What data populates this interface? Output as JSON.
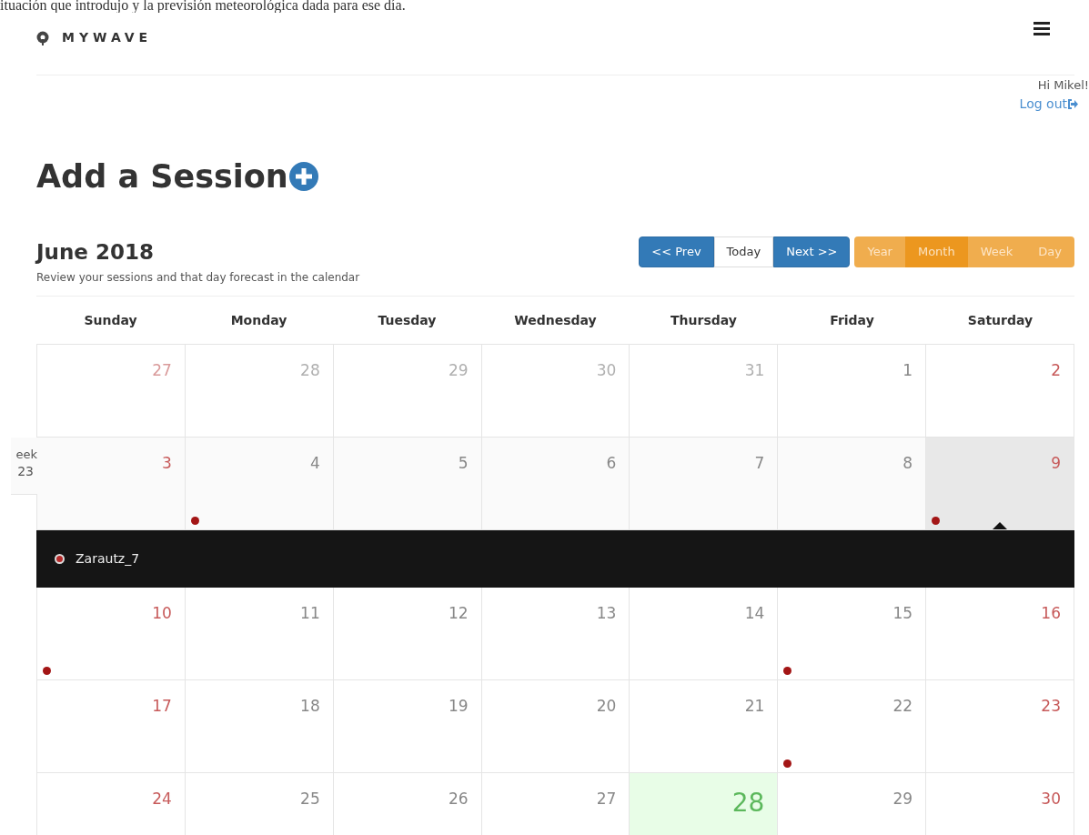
{
  "top_caption": "ituación que introdujo y la previsión meteorológica dada para ese día.",
  "brand": {
    "name": "MYWAVE"
  },
  "user": {
    "greeting": "Hi Mikel!",
    "logout": "Log out"
  },
  "page_title": "Add a Session",
  "calendar": {
    "title": "June 2018",
    "subtitle": "Review your sessions and that day forecast in the calendar",
    "nav": [
      {
        "label": "<< Prev",
        "kind": "primary"
      },
      {
        "label": "Today",
        "kind": "default"
      },
      {
        "label": "Next >>",
        "kind": "primary"
      }
    ],
    "views": [
      {
        "label": "Year",
        "selected": false
      },
      {
        "label": "Month",
        "selected": true
      },
      {
        "label": "Week",
        "selected": false
      },
      {
        "label": "Day",
        "selected": false
      }
    ],
    "weekdays": [
      "Sunday",
      "Monday",
      "Tuesday",
      "Wednesday",
      "Thursday",
      "Friday",
      "Saturday"
    ],
    "weeks": [
      {
        "hovered": false,
        "days": [
          {
            "day": "27",
            "outside": true,
            "weekend": true,
            "today": false,
            "selected": false,
            "event": false
          },
          {
            "day": "28",
            "outside": true,
            "weekend": false,
            "today": false,
            "selected": false,
            "event": false
          },
          {
            "day": "29",
            "outside": true,
            "weekend": false,
            "today": false,
            "selected": false,
            "event": false
          },
          {
            "day": "30",
            "outside": true,
            "weekend": false,
            "today": false,
            "selected": false,
            "event": false
          },
          {
            "day": "31",
            "outside": true,
            "weekend": false,
            "today": false,
            "selected": false,
            "event": false
          },
          {
            "day": "1",
            "outside": false,
            "weekend": false,
            "today": false,
            "selected": false,
            "event": false
          },
          {
            "day": "2",
            "outside": false,
            "weekend": true,
            "today": false,
            "selected": false,
            "event": false
          }
        ]
      },
      {
        "hovered": true,
        "week_text": "eek",
        "week_number": "23",
        "days": [
          {
            "day": "3",
            "outside": false,
            "weekend": true,
            "today": false,
            "selected": false,
            "event": false
          },
          {
            "day": "4",
            "outside": false,
            "weekend": false,
            "today": false,
            "selected": false,
            "event": true
          },
          {
            "day": "5",
            "outside": false,
            "weekend": false,
            "today": false,
            "selected": false,
            "event": false
          },
          {
            "day": "6",
            "outside": false,
            "weekend": false,
            "today": false,
            "selected": false,
            "event": false
          },
          {
            "day": "7",
            "outside": false,
            "weekend": false,
            "today": false,
            "selected": false,
            "event": false
          },
          {
            "day": "8",
            "outside": false,
            "weekend": false,
            "today": false,
            "selected": false,
            "event": false
          },
          {
            "day": "9",
            "outside": false,
            "weekend": true,
            "today": false,
            "selected": true,
            "event": true
          }
        ],
        "events": [
          {
            "title": "Zarautz_7",
            "color": "#b52a2a"
          }
        ]
      },
      {
        "hovered": false,
        "days": [
          {
            "day": "10",
            "outside": false,
            "weekend": true,
            "today": false,
            "selected": false,
            "event": true
          },
          {
            "day": "11",
            "outside": false,
            "weekend": false,
            "today": false,
            "selected": false,
            "event": false
          },
          {
            "day": "12",
            "outside": false,
            "weekend": false,
            "today": false,
            "selected": false,
            "event": false
          },
          {
            "day": "13",
            "outside": false,
            "weekend": false,
            "today": false,
            "selected": false,
            "event": false
          },
          {
            "day": "14",
            "outside": false,
            "weekend": false,
            "today": false,
            "selected": false,
            "event": false
          },
          {
            "day": "15",
            "outside": false,
            "weekend": false,
            "today": false,
            "selected": false,
            "event": true
          },
          {
            "day": "16",
            "outside": false,
            "weekend": true,
            "today": false,
            "selected": false,
            "event": false
          }
        ]
      },
      {
        "hovered": false,
        "days": [
          {
            "day": "17",
            "outside": false,
            "weekend": true,
            "today": false,
            "selected": false,
            "event": false
          },
          {
            "day": "18",
            "outside": false,
            "weekend": false,
            "today": false,
            "selected": false,
            "event": false
          },
          {
            "day": "19",
            "outside": false,
            "weekend": false,
            "today": false,
            "selected": false,
            "event": false
          },
          {
            "day": "20",
            "outside": false,
            "weekend": false,
            "today": false,
            "selected": false,
            "event": false
          },
          {
            "day": "21",
            "outside": false,
            "weekend": false,
            "today": false,
            "selected": false,
            "event": false
          },
          {
            "day": "22",
            "outside": false,
            "weekend": false,
            "today": false,
            "selected": false,
            "event": true
          },
          {
            "day": "23",
            "outside": false,
            "weekend": true,
            "today": false,
            "selected": false,
            "event": false
          }
        ]
      },
      {
        "hovered": false,
        "days": [
          {
            "day": "24",
            "outside": false,
            "weekend": true,
            "today": false,
            "selected": false,
            "event": false
          },
          {
            "day": "25",
            "outside": false,
            "weekend": false,
            "today": false,
            "selected": false,
            "event": false
          },
          {
            "day": "26",
            "outside": false,
            "weekend": false,
            "today": false,
            "selected": false,
            "event": false
          },
          {
            "day": "27",
            "outside": false,
            "weekend": false,
            "today": false,
            "selected": false,
            "event": false
          },
          {
            "day": "28",
            "outside": false,
            "weekend": false,
            "today": true,
            "selected": false,
            "event": false
          },
          {
            "day": "29",
            "outside": false,
            "weekend": false,
            "today": false,
            "selected": false,
            "event": false
          },
          {
            "day": "30",
            "outside": false,
            "weekend": true,
            "today": false,
            "selected": false,
            "event": false
          }
        ]
      }
    ]
  }
}
